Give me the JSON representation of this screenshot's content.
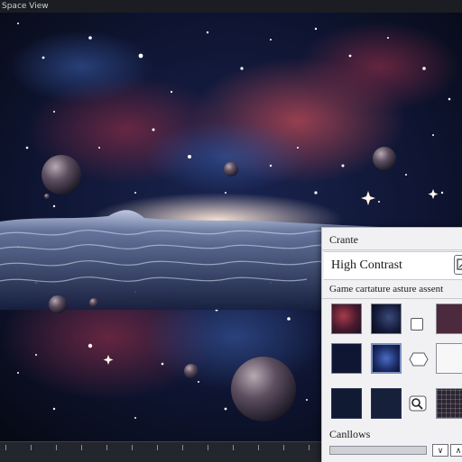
{
  "window": {
    "title": "Space View"
  },
  "panel": {
    "header": "Crante",
    "mode_value": "High Contrast",
    "subheading": "Game cartature asture assent",
    "footer_label": "Canllows",
    "buttons": {
      "down": "∨",
      "up": "∧"
    },
    "options": [
      {
        "name": "option-square"
      },
      {
        "name": "option-hexagon"
      },
      {
        "name": "option-search-cursor"
      }
    ]
  },
  "colors": {
    "panel_bg": "#f1f1f3",
    "thumb_nebula_red": "#5a1f33",
    "thumb_nebula_blue": "#1c2750",
    "thumb_dark": "#0e1530",
    "swatch_mauve": "#3a2234",
    "swatch_light": "#f7f7f8",
    "swatch_grid": "#2b2530"
  }
}
